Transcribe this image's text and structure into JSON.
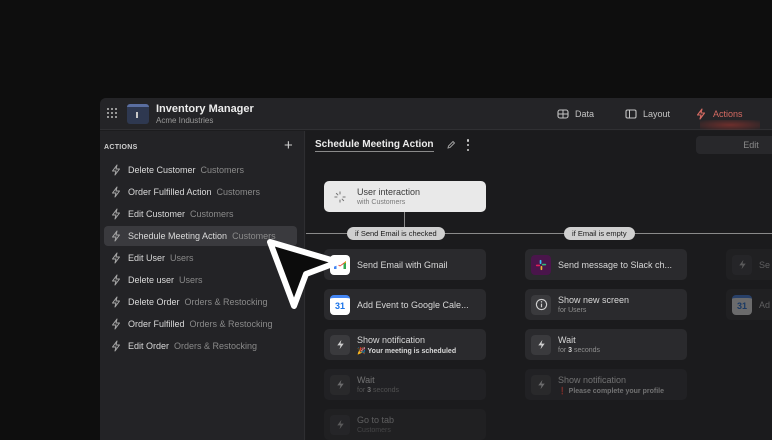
{
  "app": {
    "title": "Inventory Manager",
    "subtitle": "Acme Industries"
  },
  "nav": [
    {
      "label": "Data",
      "icon": "table-icon"
    },
    {
      "label": "Layout",
      "icon": "layout-icon"
    },
    {
      "label": "Actions",
      "icon": "bolt-icon",
      "active": true
    }
  ],
  "sidebar": {
    "header": "ACTIONS",
    "add_label": "+",
    "items": [
      {
        "name": "Delete Customer",
        "group": "Customers"
      },
      {
        "name": "Order Fulfilled Action",
        "group": "Customers"
      },
      {
        "name": "Edit Customer",
        "group": "Customers"
      },
      {
        "name": "Schedule Meeting Action",
        "group": "Customers",
        "active": true
      },
      {
        "name": "Edit User",
        "group": "Users"
      },
      {
        "name": "Delete user",
        "group": "Users"
      },
      {
        "name": "Delete Order",
        "group": "Orders & Restocking"
      },
      {
        "name": "Order Fulfilled",
        "group": "Orders & Restocking"
      },
      {
        "name": "Edit Order",
        "group": "Orders & Restocking"
      }
    ]
  },
  "canvas": {
    "title": "Schedule Meeting Action",
    "edit_label": "Edit",
    "trigger": {
      "title": "User interaction",
      "subtitle": "with Customers"
    },
    "branches": [
      {
        "condition": "if Send Email is checked",
        "nodes": [
          {
            "title": "Send Email with Gmail",
            "subtitle": "",
            "icon": "gmail-icon"
          },
          {
            "title": "Add Event to Google Cale...",
            "subtitle": "",
            "icon": "google-calendar-icon"
          },
          {
            "title": "Show notification",
            "subtitle": "🎉 Your meeting is scheduled",
            "icon": "bolt-icon"
          },
          {
            "title": "Wait",
            "subtitle_pre": "for ",
            "subtitle_bold": "3",
            "subtitle_post": " seconds",
            "icon": "bolt-icon"
          },
          {
            "title": "Go to tab",
            "subtitle": "Customers",
            "icon": "bolt-icon"
          }
        ]
      },
      {
        "condition": "if Email is empty",
        "nodes": [
          {
            "title": "Send message to Slack ch...",
            "subtitle": "",
            "icon": "slack-icon"
          },
          {
            "title": "Show new screen",
            "subtitle": "for Users",
            "icon": "info-icon"
          },
          {
            "title": "Wait",
            "subtitle_pre": "for ",
            "subtitle_bold": "3",
            "subtitle_post": " seconds",
            "icon": "bolt-icon"
          },
          {
            "title": "Show notification",
            "subtitle": "❗ Please complete your profile",
            "icon": "bolt-icon"
          }
        ]
      },
      {
        "condition": "",
        "nodes": [
          {
            "title": "Se",
            "icon": "bolt-icon"
          },
          {
            "title": "Ad",
            "icon": "google-calendar-icon"
          }
        ]
      }
    ]
  },
  "colors": {
    "background": "#0e0e0e",
    "panel": "#1c1c1e",
    "accent_red": "#d46a62",
    "node": "#2a2a2d"
  }
}
